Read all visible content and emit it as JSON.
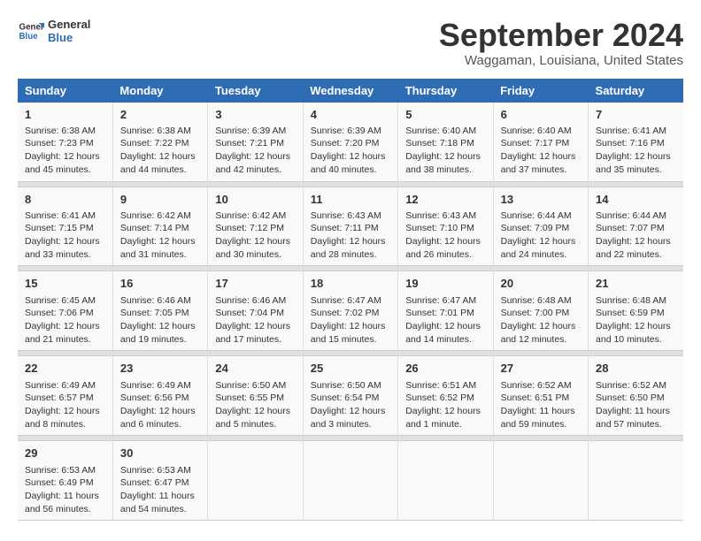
{
  "header": {
    "logo_line1": "General",
    "logo_line2": "Blue",
    "month": "September 2024",
    "location": "Waggaman, Louisiana, United States"
  },
  "columns": [
    "Sunday",
    "Monday",
    "Tuesday",
    "Wednesday",
    "Thursday",
    "Friday",
    "Saturday"
  ],
  "weeks": [
    [
      {
        "day": "1",
        "sunrise": "Sunrise: 6:38 AM",
        "sunset": "Sunset: 7:23 PM",
        "daylight": "Daylight: 12 hours and 45 minutes."
      },
      {
        "day": "2",
        "sunrise": "Sunrise: 6:38 AM",
        "sunset": "Sunset: 7:22 PM",
        "daylight": "Daylight: 12 hours and 44 minutes."
      },
      {
        "day": "3",
        "sunrise": "Sunrise: 6:39 AM",
        "sunset": "Sunset: 7:21 PM",
        "daylight": "Daylight: 12 hours and 42 minutes."
      },
      {
        "day": "4",
        "sunrise": "Sunrise: 6:39 AM",
        "sunset": "Sunset: 7:20 PM",
        "daylight": "Daylight: 12 hours and 40 minutes."
      },
      {
        "day": "5",
        "sunrise": "Sunrise: 6:40 AM",
        "sunset": "Sunset: 7:18 PM",
        "daylight": "Daylight: 12 hours and 38 minutes."
      },
      {
        "day": "6",
        "sunrise": "Sunrise: 6:40 AM",
        "sunset": "Sunset: 7:17 PM",
        "daylight": "Daylight: 12 hours and 37 minutes."
      },
      {
        "day": "7",
        "sunrise": "Sunrise: 6:41 AM",
        "sunset": "Sunset: 7:16 PM",
        "daylight": "Daylight: 12 hours and 35 minutes."
      }
    ],
    [
      {
        "day": "8",
        "sunrise": "Sunrise: 6:41 AM",
        "sunset": "Sunset: 7:15 PM",
        "daylight": "Daylight: 12 hours and 33 minutes."
      },
      {
        "day": "9",
        "sunrise": "Sunrise: 6:42 AM",
        "sunset": "Sunset: 7:14 PM",
        "daylight": "Daylight: 12 hours and 31 minutes."
      },
      {
        "day": "10",
        "sunrise": "Sunrise: 6:42 AM",
        "sunset": "Sunset: 7:12 PM",
        "daylight": "Daylight: 12 hours and 30 minutes."
      },
      {
        "day": "11",
        "sunrise": "Sunrise: 6:43 AM",
        "sunset": "Sunset: 7:11 PM",
        "daylight": "Daylight: 12 hours and 28 minutes."
      },
      {
        "day": "12",
        "sunrise": "Sunrise: 6:43 AM",
        "sunset": "Sunset: 7:10 PM",
        "daylight": "Daylight: 12 hours and 26 minutes."
      },
      {
        "day": "13",
        "sunrise": "Sunrise: 6:44 AM",
        "sunset": "Sunset: 7:09 PM",
        "daylight": "Daylight: 12 hours and 24 minutes."
      },
      {
        "day": "14",
        "sunrise": "Sunrise: 6:44 AM",
        "sunset": "Sunset: 7:07 PM",
        "daylight": "Daylight: 12 hours and 22 minutes."
      }
    ],
    [
      {
        "day": "15",
        "sunrise": "Sunrise: 6:45 AM",
        "sunset": "Sunset: 7:06 PM",
        "daylight": "Daylight: 12 hours and 21 minutes."
      },
      {
        "day": "16",
        "sunrise": "Sunrise: 6:46 AM",
        "sunset": "Sunset: 7:05 PM",
        "daylight": "Daylight: 12 hours and 19 minutes."
      },
      {
        "day": "17",
        "sunrise": "Sunrise: 6:46 AM",
        "sunset": "Sunset: 7:04 PM",
        "daylight": "Daylight: 12 hours and 17 minutes."
      },
      {
        "day": "18",
        "sunrise": "Sunrise: 6:47 AM",
        "sunset": "Sunset: 7:02 PM",
        "daylight": "Daylight: 12 hours and 15 minutes."
      },
      {
        "day": "19",
        "sunrise": "Sunrise: 6:47 AM",
        "sunset": "Sunset: 7:01 PM",
        "daylight": "Daylight: 12 hours and 14 minutes."
      },
      {
        "day": "20",
        "sunrise": "Sunrise: 6:48 AM",
        "sunset": "Sunset: 7:00 PM",
        "daylight": "Daylight: 12 hours and 12 minutes."
      },
      {
        "day": "21",
        "sunrise": "Sunrise: 6:48 AM",
        "sunset": "Sunset: 6:59 PM",
        "daylight": "Daylight: 12 hours and 10 minutes."
      }
    ],
    [
      {
        "day": "22",
        "sunrise": "Sunrise: 6:49 AM",
        "sunset": "Sunset: 6:57 PM",
        "daylight": "Daylight: 12 hours and 8 minutes."
      },
      {
        "day": "23",
        "sunrise": "Sunrise: 6:49 AM",
        "sunset": "Sunset: 6:56 PM",
        "daylight": "Daylight: 12 hours and 6 minutes."
      },
      {
        "day": "24",
        "sunrise": "Sunrise: 6:50 AM",
        "sunset": "Sunset: 6:55 PM",
        "daylight": "Daylight: 12 hours and 5 minutes."
      },
      {
        "day": "25",
        "sunrise": "Sunrise: 6:50 AM",
        "sunset": "Sunset: 6:54 PM",
        "daylight": "Daylight: 12 hours and 3 minutes."
      },
      {
        "day": "26",
        "sunrise": "Sunrise: 6:51 AM",
        "sunset": "Sunset: 6:52 PM",
        "daylight": "Daylight: 12 hours and 1 minute."
      },
      {
        "day": "27",
        "sunrise": "Sunrise: 6:52 AM",
        "sunset": "Sunset: 6:51 PM",
        "daylight": "Daylight: 11 hours and 59 minutes."
      },
      {
        "day": "28",
        "sunrise": "Sunrise: 6:52 AM",
        "sunset": "Sunset: 6:50 PM",
        "daylight": "Daylight: 11 hours and 57 minutes."
      }
    ],
    [
      {
        "day": "29",
        "sunrise": "Sunrise: 6:53 AM",
        "sunset": "Sunset: 6:49 PM",
        "daylight": "Daylight: 11 hours and 56 minutes."
      },
      {
        "day": "30",
        "sunrise": "Sunrise: 6:53 AM",
        "sunset": "Sunset: 6:47 PM",
        "daylight": "Daylight: 11 hours and 54 minutes."
      },
      {
        "day": "",
        "sunrise": "",
        "sunset": "",
        "daylight": ""
      },
      {
        "day": "",
        "sunrise": "",
        "sunset": "",
        "daylight": ""
      },
      {
        "day": "",
        "sunrise": "",
        "sunset": "",
        "daylight": ""
      },
      {
        "day": "",
        "sunrise": "",
        "sunset": "",
        "daylight": ""
      },
      {
        "day": "",
        "sunrise": "",
        "sunset": "",
        "daylight": ""
      }
    ]
  ]
}
